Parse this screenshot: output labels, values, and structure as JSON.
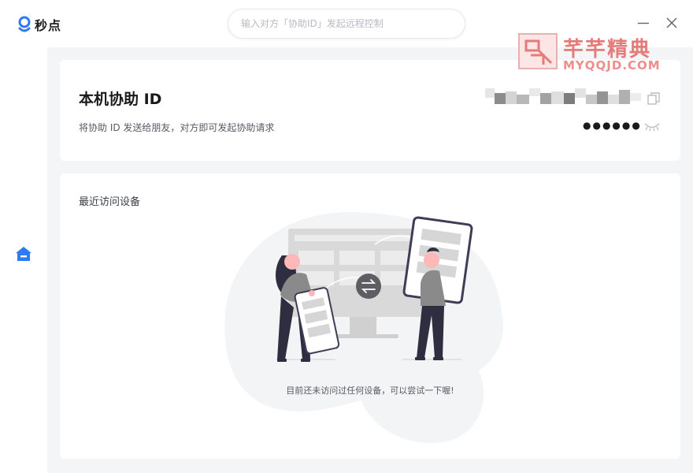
{
  "app": {
    "name": "秒点"
  },
  "search": {
    "placeholder": "输入对方「协助ID」发起远程控制"
  },
  "watermark": {
    "title": "芊芊精典",
    "subtitle": "MYQQJD.COM"
  },
  "id_card": {
    "title": "本机协助 ID",
    "description": "将协助 ID 发送给朋友，对方即可发起协助请求",
    "password_masked": "●●●●●●"
  },
  "recent": {
    "title": "最近访问设备",
    "empty_text": "目前还未访问过任何设备，可以尝试一下喔!"
  },
  "icons": {
    "logo": "miaodian-logo-icon",
    "minimize": "minimize-icon",
    "close": "close-icon",
    "home": "home-icon",
    "copy": "copy-icon",
    "hidden": "eye-closed-icon",
    "transfer": "swap-arrows-icon"
  },
  "colors": {
    "accent": "#2f7bf5",
    "watermark": "#e57b7b"
  }
}
